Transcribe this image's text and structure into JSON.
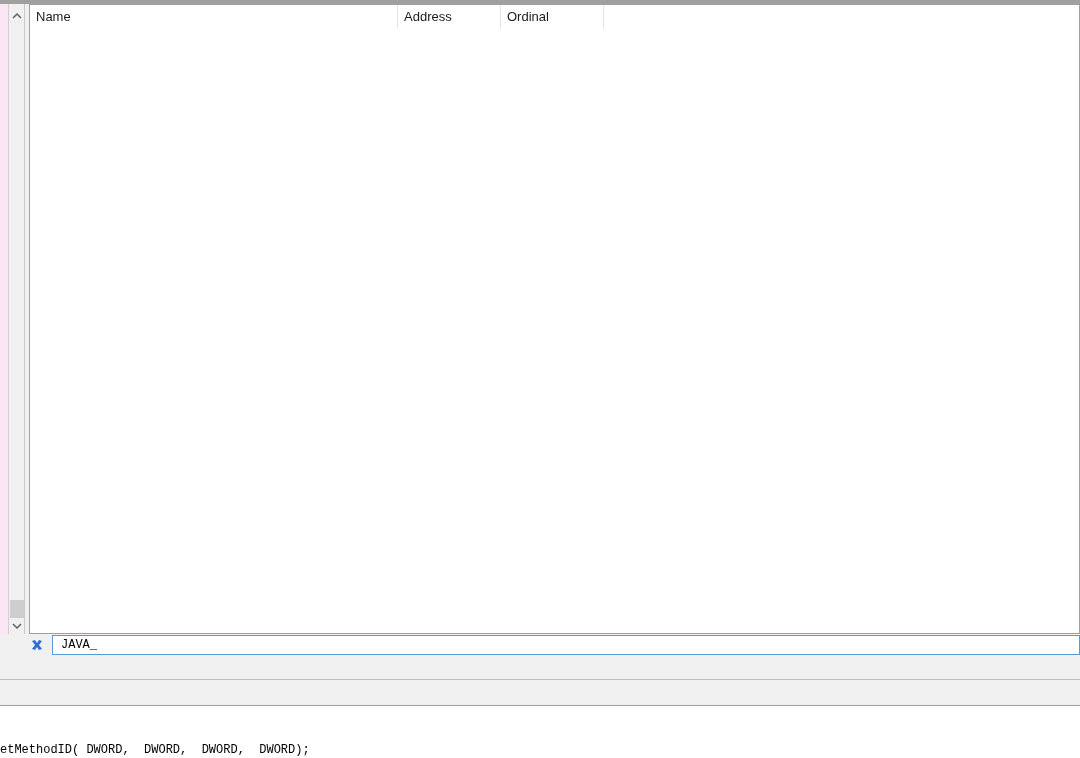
{
  "exports_table": {
    "columns": [
      "Name",
      "Address",
      "Ordinal"
    ]
  },
  "filter": {
    "value": "JAVA_"
  },
  "code": {
    "lines": [
      "etMethodID( DWORD,  DWORD,  DWORD,  DWORD);"
    ]
  }
}
